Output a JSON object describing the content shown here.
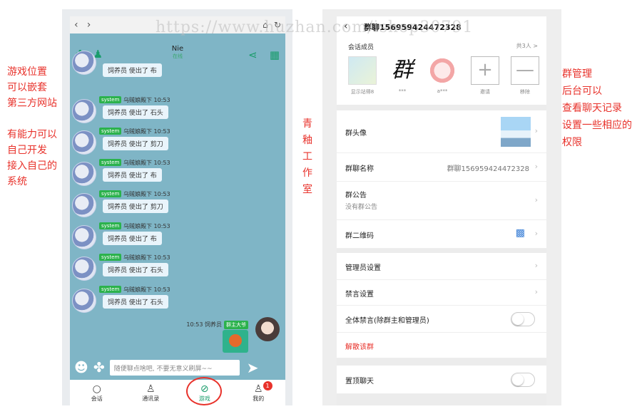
{
  "watermark": "https://www.huzhan.com/ishop30791",
  "notes": {
    "left_1": [
      "游戏位置",
      "可以嵌套",
      "第三方网站"
    ],
    "left_2": [
      "有能力可以",
      "自己开发",
      "接入自己的",
      "系统"
    ],
    "studio": [
      "青",
      "釉",
      "工",
      "作",
      "室"
    ],
    "right": [
      "群管理",
      "后台可以",
      "查看聊天记录",
      "设置一些相应的",
      "权限"
    ]
  },
  "left_phone": {
    "nav": {
      "back": "‹",
      "forward": "›",
      "home": "⌂",
      "refresh": "↻"
    },
    "game_title": "Nie",
    "game_status": "在线",
    "messages": [
      {
        "tag": "",
        "sender": "",
        "text": "饲养员 使出了 布"
      },
      {
        "tag": "system",
        "sender": "乌贼娘殿下 10:53",
        "text": "饲养员 使出了 石头"
      },
      {
        "tag": "system",
        "sender": "乌贼娘殿下 10:53",
        "text": "饲养员 使出了 剪刀"
      },
      {
        "tag": "system",
        "sender": "乌贼娘殿下 10:53",
        "text": "饲养员 使出了 布"
      },
      {
        "tag": "system",
        "sender": "乌贼娘殿下 10:53",
        "text": "饲养员 使出了 剪刀"
      },
      {
        "tag": "system",
        "sender": "乌贼娘殿下 10:53",
        "text": "饲养员 使出了 布"
      },
      {
        "tag": "system",
        "sender": "乌贼娘殿下 10:53",
        "text": "饲养员 使出了 石头"
      },
      {
        "tag": "system",
        "sender": "乌贼娘殿下 10:53",
        "text": "饲养员 使出了 石头"
      }
    ],
    "my_message": {
      "meta": "10:53 饲养员",
      "tag": "群主大爷"
    },
    "input_placeholder": "随便聊点啥吧, 不要无意义刷屏~~",
    "tabs": [
      {
        "label": "会话",
        "icon": "○"
      },
      {
        "label": "通讯录",
        "icon": "♙"
      },
      {
        "label": "游戏",
        "icon": "⊘"
      },
      {
        "label": "我的",
        "icon": "♙",
        "badge": "1"
      }
    ]
  },
  "right_phone": {
    "header": {
      "back": "‹",
      "title": "群聊156959424472328"
    },
    "members": {
      "label": "会话成员",
      "count": "共3人 >",
      "items": [
        {
          "name": "显示站得8",
          "glyph": ""
        },
        {
          "name": "***",
          "glyph": "群"
        },
        {
          "name": "a***",
          "glyph": ""
        },
        {
          "name": "邀请",
          "glyph": "+"
        },
        {
          "name": "移除",
          "glyph": "—"
        }
      ]
    },
    "rows": {
      "avatar_label": "群头像",
      "name_label": "群聊名称",
      "name_value": "群聊156959424472328",
      "notice_label": "群公告",
      "notice_sub": "没有群公告",
      "qr_label": "群二维码",
      "admin_label": "管理员设置",
      "mute_label": "禁言设置",
      "mute_all_label": "全体禁言(除群主和管理员)",
      "dissolve_label": "解散该群",
      "pin_label": "置顶聊天"
    },
    "chevron": "›"
  }
}
